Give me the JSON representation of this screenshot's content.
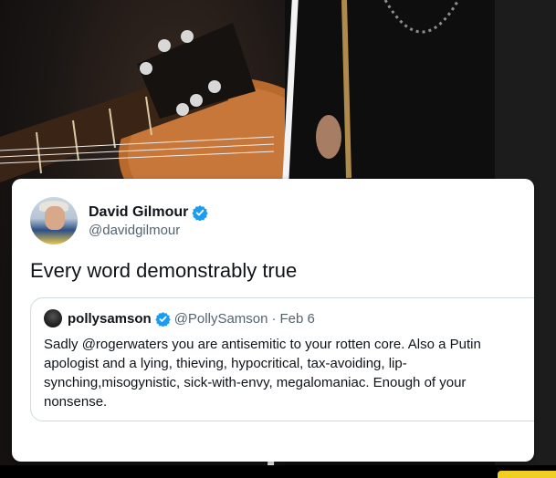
{
  "tweet": {
    "author": {
      "display_name": "David Gilmour",
      "handle": "@davidgilmour",
      "verified": true,
      "avatar_icon": "avatar-photo"
    },
    "text": "Every word demonstrably true",
    "quoted": {
      "author": {
        "display_name": "pollysamson",
        "handle": "@PollySamson",
        "verified": true
      },
      "separator": "·",
      "date": "Feb 6",
      "text": "Sadly @rogerwaters you are antisemitic to your rotten core. Also a Putin apologist and a lying, thieving, hypocritical, tax-avoiding, lip-synching,misogynistic, sick-with-envy, megalomaniac. Enough of your nonsense."
    }
  },
  "colors": {
    "verified_blue": "#1d9bf0",
    "text_primary": "#0f1419",
    "text_secondary": "#536471",
    "card_border": "#cfd9de"
  }
}
